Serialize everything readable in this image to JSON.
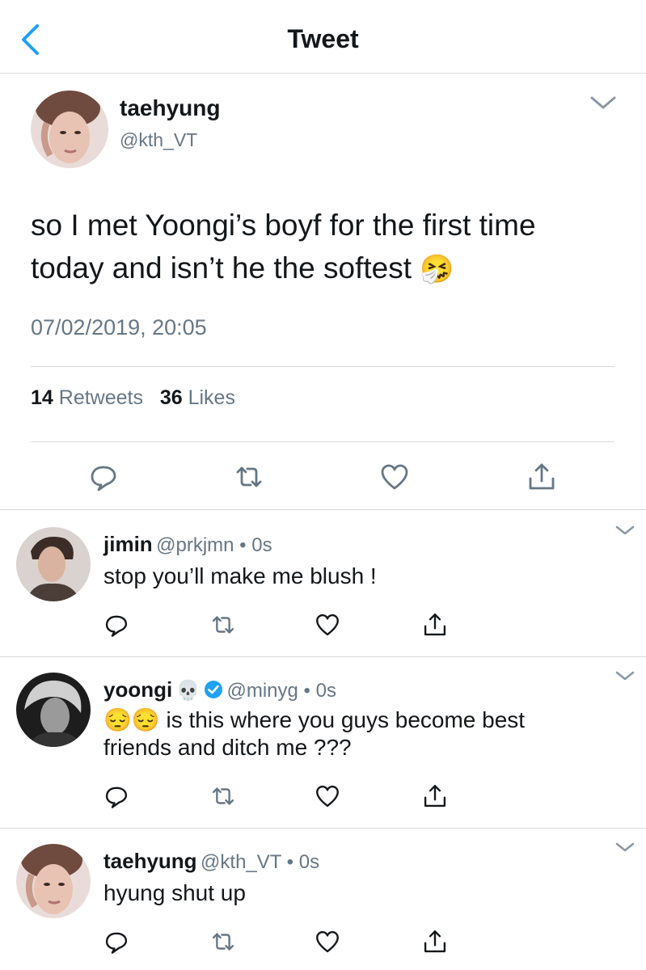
{
  "header": {
    "title": "Tweet",
    "back_icon": "chevron-left-icon",
    "accent": "#1da1f2"
  },
  "main_tweet": {
    "name": "taehyung",
    "handle": "@kth_VT",
    "text_line1": "so I met Yoongi’s boyf for the first time",
    "text_line2": "today and isn’t he the softest",
    "emoji": "🤧",
    "timestamp": "07/02/2019, 20:05",
    "retweet_count": "14",
    "retweet_label": "Retweets",
    "like_count": "36",
    "like_label": "Likes"
  },
  "replies": [
    {
      "name": "jimin",
      "meta": "@prkjmn • 0s",
      "text": "stop you’ll make me blush !"
    },
    {
      "name": "yoongi",
      "name_emoji": "💀",
      "verified": true,
      "meta": "@minyg • 0s",
      "text_emoji": "😔😔",
      "text_line1": "is this where you guys become best",
      "text_line2": "friends and ditch me ???"
    },
    {
      "name": "taehyung",
      "meta": "@kth_VT • 0s",
      "text": "hyung shut up"
    }
  ],
  "icons": [
    "reply-icon",
    "retweet-icon",
    "like-icon",
    "share-icon",
    "chevron-down-icon",
    "verified-badge-icon"
  ],
  "colors": {
    "text": "#14171a",
    "secondary": "#657786",
    "divider": "#d6dadd",
    "verified": "#1da1f2"
  }
}
